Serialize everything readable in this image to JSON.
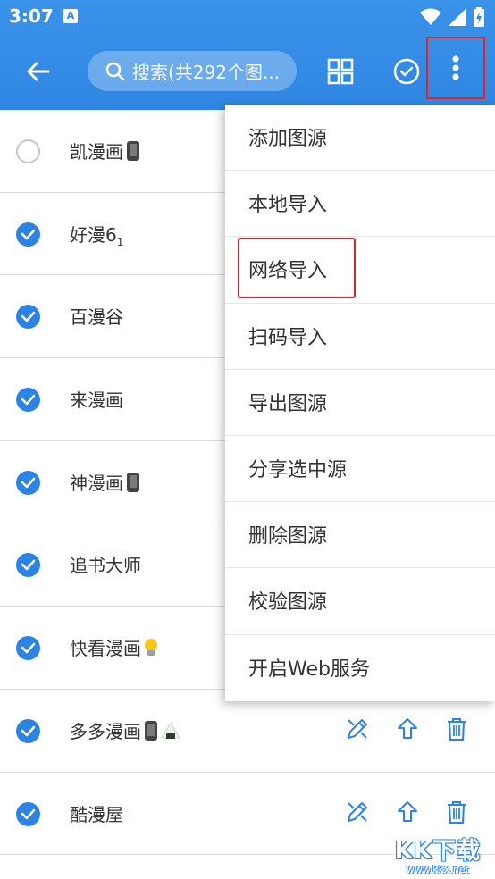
{
  "status_bar": {
    "time": "3:07",
    "notification_badge": "A"
  },
  "toolbar": {
    "search_placeholder": "搜索(共292个图...",
    "accent_color": "#2f86e2",
    "highlight_color": "#e0242a"
  },
  "sources": [
    {
      "name": "凯漫画",
      "checked": false,
      "emoji": [
        "phone"
      ]
    },
    {
      "name": "好漫6",
      "subscript": "1",
      "checked": true,
      "emoji": []
    },
    {
      "name": "百漫谷",
      "checked": true,
      "emoji": []
    },
    {
      "name": "来漫画",
      "checked": true,
      "emoji": []
    },
    {
      "name": "神漫画",
      "checked": true,
      "emoji": [
        "phone"
      ]
    },
    {
      "name": "追书大师",
      "checked": true,
      "emoji": []
    },
    {
      "name": "快看漫画",
      "checked": true,
      "emoji": [
        "bulb"
      ]
    },
    {
      "name": "多多漫画",
      "checked": true,
      "emoji": [
        "phone",
        "rice-ball"
      ]
    },
    {
      "name": "酷漫屋",
      "checked": true,
      "emoji": []
    }
  ],
  "menu": {
    "items": [
      "添加图源",
      "本地导入",
      "网络导入",
      "扫码导入",
      "导出图源",
      "分享选中源",
      "删除图源",
      "校验图源",
      "开启Web服务"
    ],
    "highlighted_index": 2
  },
  "watermark": {
    "logo": "KK下载",
    "url": "www.kkx.net"
  }
}
